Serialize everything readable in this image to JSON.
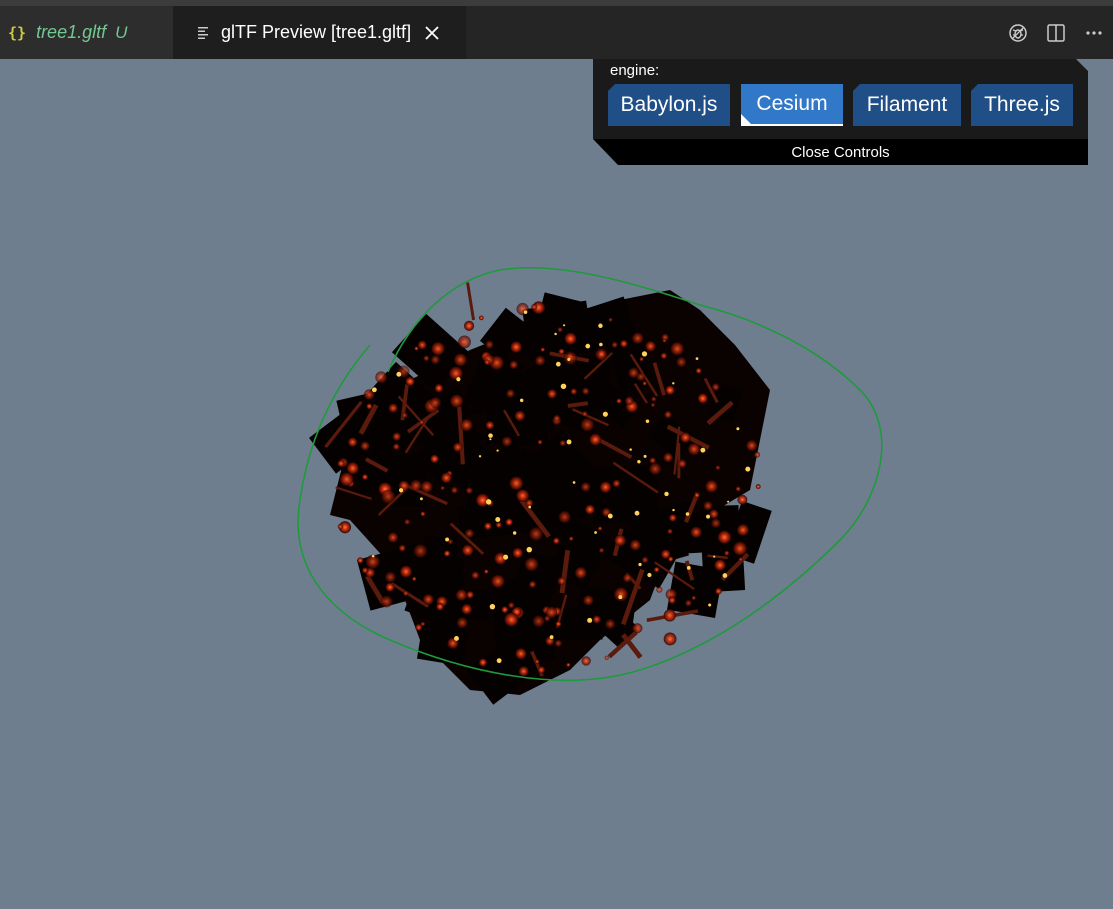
{
  "tabs": [
    {
      "icon": "{}",
      "label": "tree1.gltf",
      "status": "U",
      "active": false
    },
    {
      "icon": "preview-icon",
      "label": "glTF Preview [tree1.gltf]",
      "active": true
    }
  ],
  "editor_actions": [
    "debug-icon",
    "split-editor-icon",
    "more-actions-icon"
  ],
  "controls": {
    "label": "engine:",
    "engines": [
      "Babylon.js",
      "Cesium",
      "Filament",
      "Three.js"
    ],
    "selected": "Cesium",
    "close_label": "Close Controls"
  },
  "colors": {
    "viewport_background": "#6f7e8f",
    "engine_button": "#1f4f86",
    "engine_button_selected": "#3278c8",
    "bounding_outline": "#1e9a3c",
    "untracked_file": "#73c991"
  }
}
